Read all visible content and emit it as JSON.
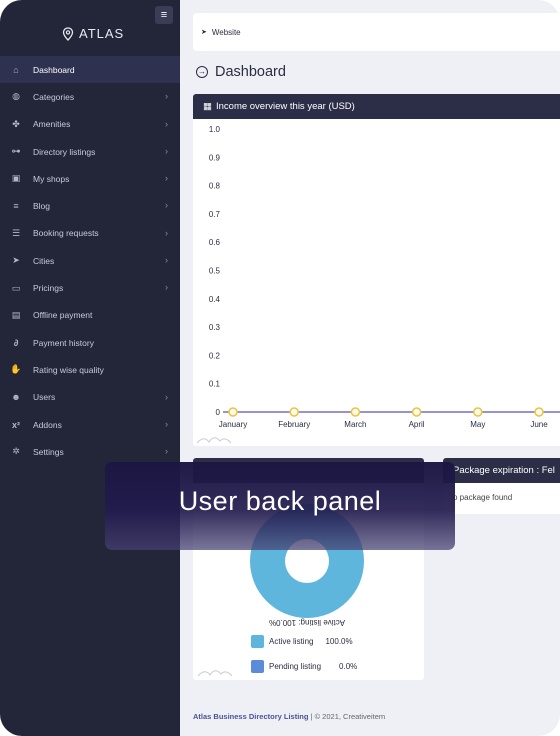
{
  "app": {
    "logo_text": "ATLAS"
  },
  "sidebar": {
    "items": [
      {
        "label": "Dashboard",
        "icon": "home-icon",
        "glyph": "⌂",
        "chevron": false,
        "active": true
      },
      {
        "label": "Categories",
        "icon": "globe-icon",
        "glyph": "◍",
        "chevron": true
      },
      {
        "label": "Amenities",
        "icon": "puzzle-icon",
        "glyph": "✤",
        "chevron": true
      },
      {
        "label": "Directory listings",
        "icon": "sitemap-icon",
        "glyph": "⊶",
        "chevron": true
      },
      {
        "label": "My shops",
        "icon": "shopping-bag-icon",
        "glyph": "▣",
        "chevron": true
      },
      {
        "label": "Blog",
        "icon": "align-left-icon",
        "glyph": "≡",
        "chevron": true
      },
      {
        "label": "Booking requests",
        "icon": "list-icon",
        "glyph": "☰",
        "chevron": true
      },
      {
        "label": "Cities",
        "icon": "location-arrow-icon",
        "glyph": "➤",
        "chevron": true
      },
      {
        "label": "Pricings",
        "icon": "credit-card-icon",
        "glyph": "▭",
        "chevron": true
      },
      {
        "label": "Offline payment",
        "icon": "archive-icon",
        "glyph": "▤",
        "chevron": false
      },
      {
        "label": "Payment history",
        "icon": "paperclip-icon",
        "glyph": "∂",
        "chevron": false
      },
      {
        "label": "Rating wise quality",
        "icon": "thumbs-up-icon",
        "glyph": "✋",
        "chevron": false
      },
      {
        "label": "Users",
        "icon": "users-icon",
        "glyph": "☻",
        "chevron": true
      },
      {
        "label": "Addons",
        "icon": "superscript-icon",
        "glyph": "x²",
        "chevron": true
      },
      {
        "label": "Settings",
        "icon": "cogs-icon",
        "glyph": "✲",
        "chevron": true
      }
    ],
    "chevron_glyph": "›",
    "toggle_glyph": "≡"
  },
  "topbar": {
    "link_label": "Website",
    "link_glyph": "➤"
  },
  "page": {
    "title": "Dashboard",
    "title_glyph": "→"
  },
  "income_card": {
    "title": "Income overview this year (USD)",
    "title_glyph": "▦"
  },
  "chart_data": {
    "type": "line",
    "title": "Income overview this year (USD)",
    "categories": [
      "January",
      "February",
      "March",
      "April",
      "May",
      "June"
    ],
    "series": [
      {
        "values": [
          0,
          0,
          0,
          0,
          0,
          0
        ],
        "color": "#5b4fb8",
        "point_color": "#e8c440"
      }
    ],
    "yticks": [
      "1.0",
      "0.9",
      "0.8",
      "0.7",
      "0.6",
      "0.5",
      "0.4",
      "0.3",
      "0.2",
      "0.1",
      "0"
    ],
    "ylim": [
      0,
      1
    ],
    "grid": false
  },
  "listing_chart": {
    "type": "pie",
    "slices": [
      {
        "label": "Active listing",
        "value": 100.0,
        "color": "#5fb6dd"
      },
      {
        "label": "Pending listing",
        "value": 0.0,
        "color": "#5b8bd9"
      }
    ],
    "slice_label": "Active listing: 100.0%",
    "legend": [
      {
        "label": "Active listing",
        "value": "100.0%",
        "color": "#5fb6dd"
      },
      {
        "label": "Pending listing",
        "value": "0.0%",
        "color": "#5b8bd9"
      }
    ]
  },
  "package_card": {
    "title": "Package expiration : Fel",
    "body": "o package found"
  },
  "footer": {
    "brand": "Atlas Business Directory Listing",
    "rest": " | © 2021, Creativeitem"
  },
  "banner": {
    "text": "User back panel"
  }
}
